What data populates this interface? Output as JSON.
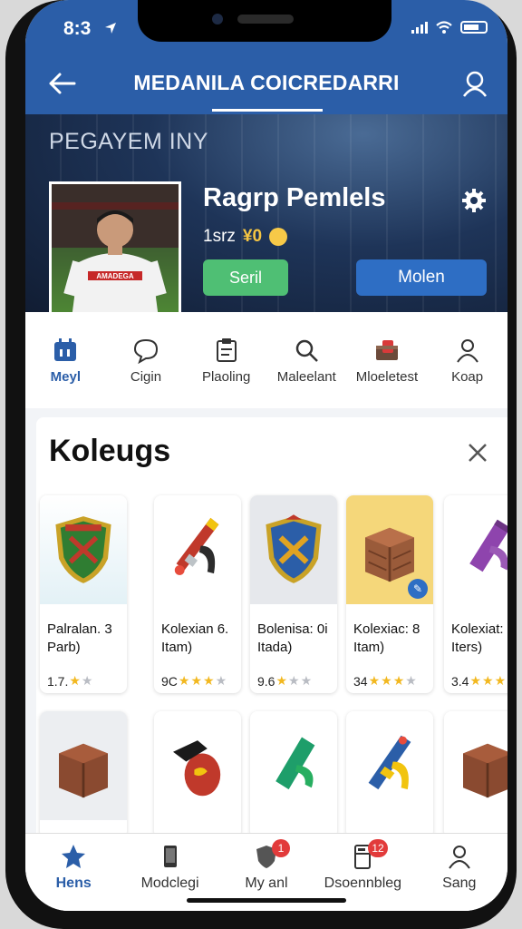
{
  "status": {
    "time": "8:3"
  },
  "appbar": {
    "title": "MEDANILA COICREDARRI"
  },
  "hero": {
    "section_tag": "PEGAYEM INY",
    "player_name": "Ragrp Pemlels",
    "meta_label": "1srz",
    "coin_label": "¥0",
    "green_button": "Seril",
    "blue_button": "Molen",
    "jersey_text": "AMADEGA"
  },
  "quicknav": [
    {
      "label": "Meyl",
      "icon": "calendar-icon"
    },
    {
      "label": "Cigin",
      "icon": "chat-icon"
    },
    {
      "label": "Plaoling",
      "icon": "clipboard-icon"
    },
    {
      "label": "Maleelant",
      "icon": "search-icon"
    },
    {
      "label": "Mloeletest",
      "icon": "trophy-box-icon"
    },
    {
      "label": "Koap",
      "icon": "person-icon"
    }
  ],
  "collection": {
    "heading": "Koleugs",
    "items_row1": [
      {
        "name": "Palralan. 3\nParb)",
        "rating": "1.7.",
        "stars": 2
      },
      {
        "name": "Kolexian 6.\nItam)",
        "rating": "9C",
        "stars": 3
      },
      {
        "name": "Bolenisa: 0i\nItada)",
        "rating": "9.6",
        "stars": 3
      },
      {
        "name": "Kolexiac: 8\nItam)",
        "rating": "34",
        "stars": 3
      },
      {
        "name": "Kolexiat: 8\nIters)",
        "rating": "3.4",
        "stars": 3
      }
    ]
  },
  "tabbar": [
    {
      "label": "Hens",
      "icon": "star-icon"
    },
    {
      "label": "Modclegi",
      "icon": "phone-icon"
    },
    {
      "label": "My anl",
      "icon": "shield-icon",
      "badge": "1"
    },
    {
      "label": "Dsoennbleg",
      "icon": "locker-icon",
      "badge": "12"
    },
    {
      "label": "Sang",
      "icon": "person-icon"
    }
  ],
  "colors": {
    "primary": "#2b5ea8",
    "green": "#4fbf74",
    "star": "#f2b820"
  }
}
